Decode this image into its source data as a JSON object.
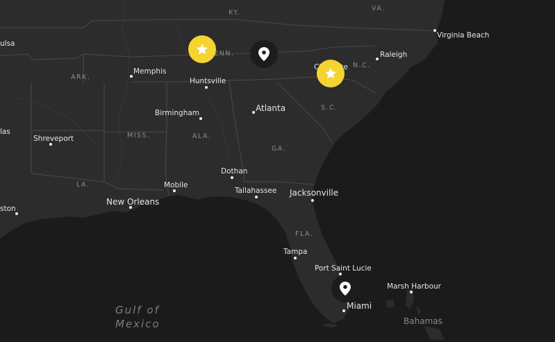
{
  "colors": {
    "land": "#2d2c2c",
    "water": "#1b1b1b",
    "borders": "#4a4a4a",
    "star_marker": "#f5d331",
    "pin_marker": "#1c1c1c"
  },
  "cities": [
    {
      "name": "Virginia Beach"
    },
    {
      "name": "Raleigh"
    },
    {
      "name": "Charlotte"
    },
    {
      "name": "Memphis"
    },
    {
      "name": "Huntsville"
    },
    {
      "name": "Birmingham"
    },
    {
      "name": "Atlanta"
    },
    {
      "name": "Shreveport"
    },
    {
      "name": "Dothan"
    },
    {
      "name": "Mobile"
    },
    {
      "name": "Tallahassee"
    },
    {
      "name": "Jacksonville"
    },
    {
      "name": "New Orleans"
    },
    {
      "name": "Tampa"
    },
    {
      "name": "Port Saint Lucie"
    },
    {
      "name": "Miami"
    },
    {
      "name": "Marsh Harbour"
    }
  ],
  "partial_labels": {
    "tulsa": "ulsa",
    "dallas": "las",
    "houston": "ston"
  },
  "state_labels": {
    "ky": "KY.",
    "va": "VA.",
    "tn": "TENN.",
    "nc": "N.C.",
    "ark": "ARK.",
    "sc": "S.C.",
    "miss": "MISS.",
    "ala": "ALA.",
    "ga": "GA.",
    "la": "LA.",
    "fla": "FLA."
  },
  "water_labels": {
    "gulf_line1": "Gulf of",
    "gulf_line2": "Mexico"
  },
  "region_labels": {
    "bahamas": "Bahamas"
  },
  "markers": [
    {
      "type": "star",
      "icon": "star-icon"
    },
    {
      "type": "pin",
      "icon": "map-pin-icon"
    },
    {
      "type": "star",
      "icon": "star-icon"
    },
    {
      "type": "pin",
      "icon": "map-pin-icon"
    }
  ]
}
